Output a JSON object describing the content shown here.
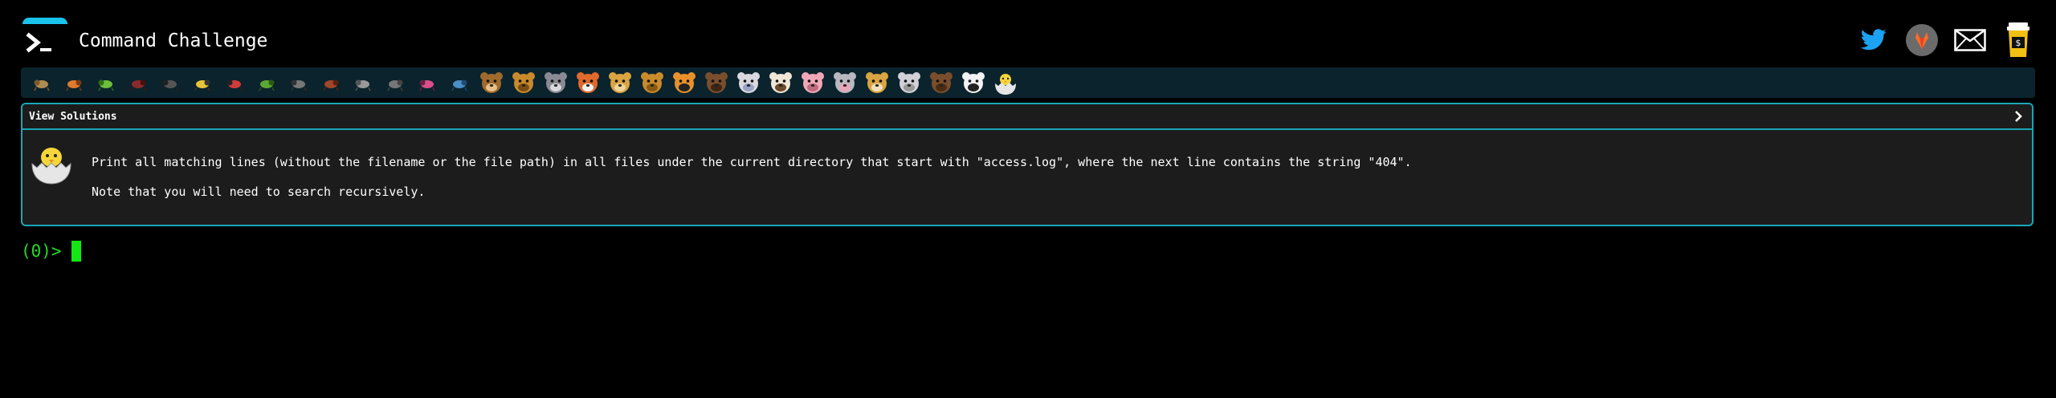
{
  "header": {
    "brand": "Command Challenge",
    "social": [
      {
        "icon": "twitter-icon",
        "color": "#1da1f2"
      },
      {
        "icon": "gitlab-icon",
        "color": "#fc6d26"
      },
      {
        "icon": "mail-icon",
        "color": "#ffffff"
      },
      {
        "icon": "coffee-icon",
        "color": "#f2c014"
      }
    ]
  },
  "levels": [
    {
      "icon": "snail-icon"
    },
    {
      "icon": "butterfly-icon"
    },
    {
      "icon": "caterpillar-icon"
    },
    {
      "icon": "ant-icon"
    },
    {
      "icon": "spider-icon"
    },
    {
      "icon": "bee-icon"
    },
    {
      "icon": "ladybug-icon"
    },
    {
      "icon": "worm-icon"
    },
    {
      "icon": "mosquito-icon"
    },
    {
      "icon": "scorpion-icon"
    },
    {
      "icon": "bird-icon"
    },
    {
      "icon": "bat-icon"
    },
    {
      "icon": "snake-icon"
    },
    {
      "icon": "fish-icon"
    },
    {
      "icon": "monkey-icon"
    },
    {
      "icon": "dog-icon"
    },
    {
      "icon": "wolf-icon"
    },
    {
      "icon": "fox-icon"
    },
    {
      "icon": "cat-icon"
    },
    {
      "icon": "lion-icon"
    },
    {
      "icon": "tiger-icon"
    },
    {
      "icon": "horse-icon"
    },
    {
      "icon": "unicorn-icon"
    },
    {
      "icon": "cow-icon"
    },
    {
      "icon": "pig-icon"
    },
    {
      "icon": "mouse-icon"
    },
    {
      "icon": "hamster-icon"
    },
    {
      "icon": "rabbit-icon"
    },
    {
      "icon": "bear-icon"
    },
    {
      "icon": "panda-icon"
    },
    {
      "icon": "hatching-chick-icon"
    }
  ],
  "challenge": {
    "view_solutions": "View Solutions",
    "description": "Print all matching lines (without the filename or the file path) in all files under the current directory that start with \"access.log\", where the next line contains the string \"404\".",
    "note": "Note that you will need to search recursively.",
    "icon": "hatching-chick-icon"
  },
  "prompt": {
    "text": "(0)>"
  },
  "colors": {
    "accent": "#1aa6b7",
    "prompt_green": "#22dd22",
    "level_bar": "#0b232c"
  }
}
